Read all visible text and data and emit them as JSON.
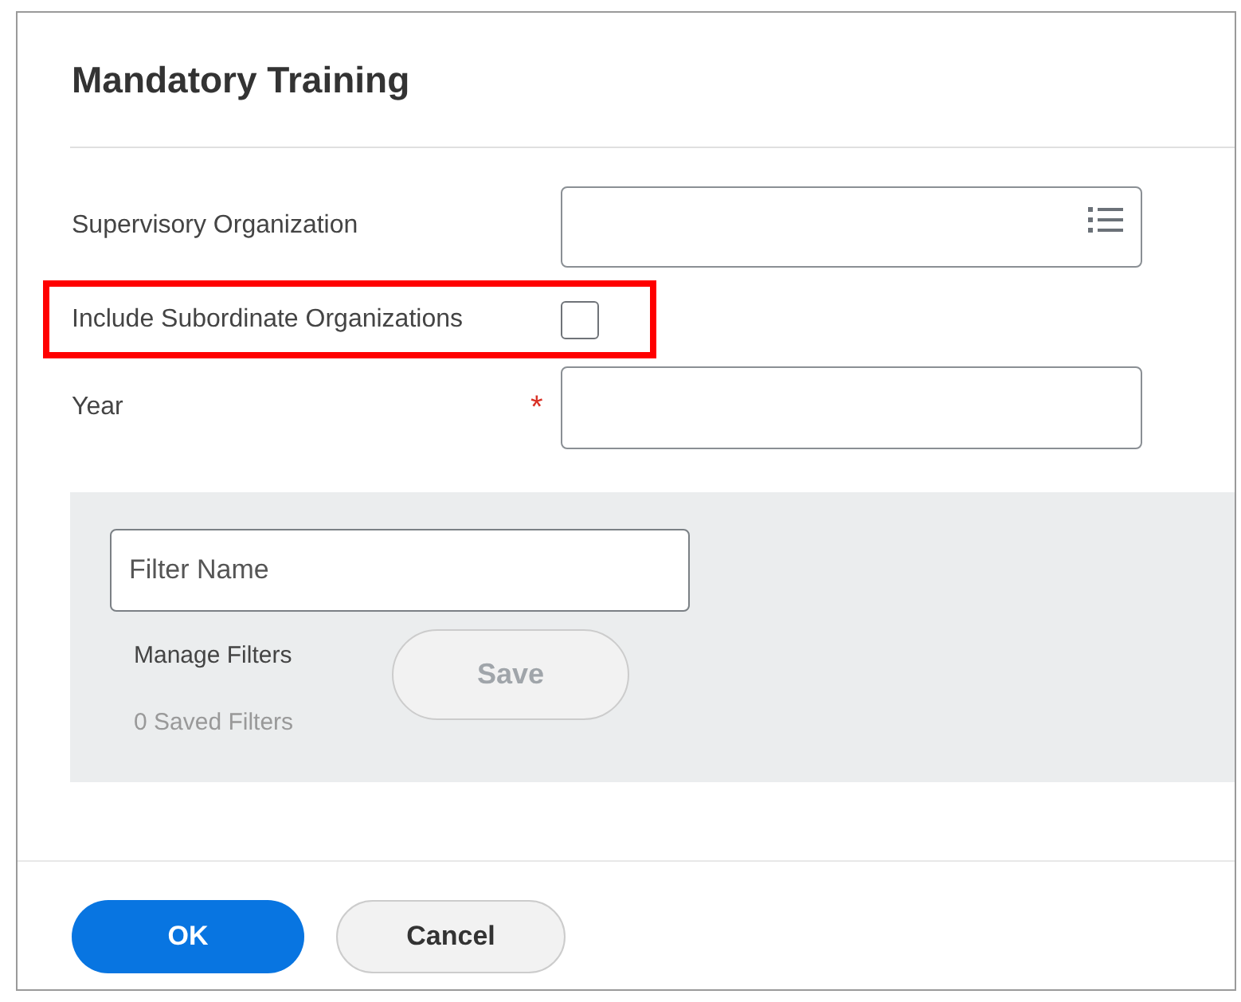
{
  "title": "Mandatory Training",
  "fields": [
    {
      "kind": "select",
      "label": "Supervisory Organization",
      "required": false,
      "highlighted": false
    },
    {
      "kind": "checkbox",
      "label": "Include Subordinate Organizations",
      "checked": false,
      "required": false,
      "highlighted": true
    },
    {
      "kind": "text",
      "label": "Year",
      "required": true,
      "highlighted": false
    }
  ],
  "required_mark": "*",
  "filter_panel": {
    "filter_name": {
      "placeholder": "Filter Name"
    },
    "manage_filters": "Manage Filters",
    "saved_filters": "0 Saved Filters",
    "save_button": {
      "label": "Save",
      "disabled": true
    }
  },
  "buttons": [
    {
      "label": "OK",
      "kind": "primary"
    },
    {
      "label": "Cancel",
      "kind": "secondary"
    }
  ]
}
